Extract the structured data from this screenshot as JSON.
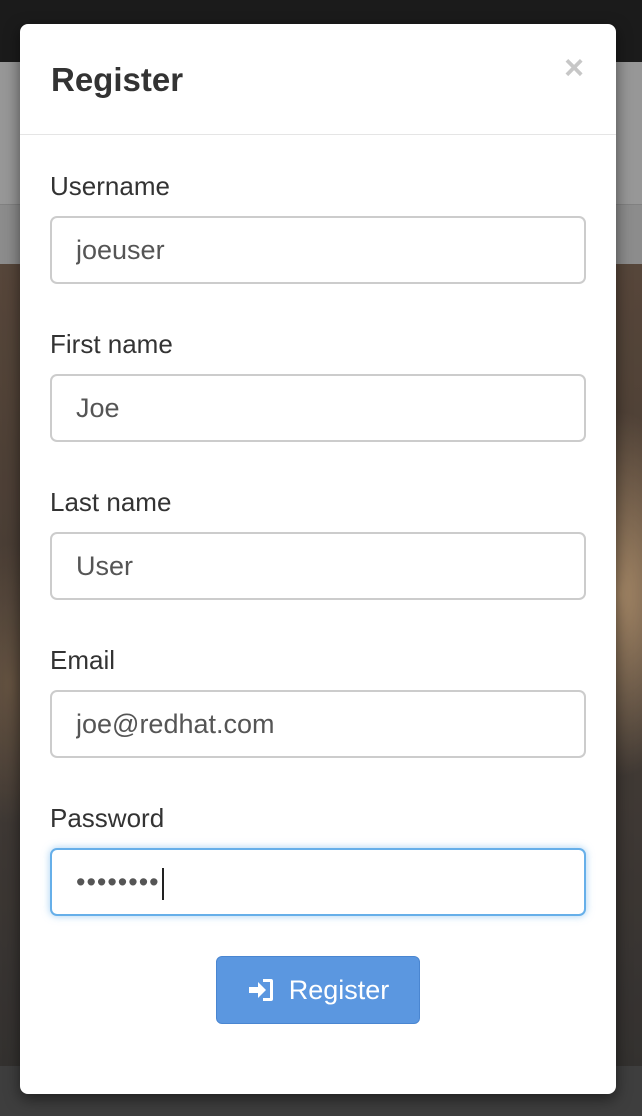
{
  "modal": {
    "title": "Register",
    "close_glyph": "×",
    "close_icon": "close-icon"
  },
  "form": {
    "fields": [
      {
        "label": "Username",
        "value": "joeuser"
      },
      {
        "label": "First name",
        "value": "Joe"
      },
      {
        "label": "Last name",
        "value": "User"
      },
      {
        "label": "Email",
        "value": "joe@redhat.com"
      },
      {
        "label": "Password",
        "value": "••••••••",
        "focused": true
      }
    ],
    "submit": {
      "label": "Register",
      "icon": "sign-in-icon"
    }
  },
  "colors": {
    "primary": "#5b97e0",
    "focus_border": "#66afe9",
    "text": "#333333"
  }
}
